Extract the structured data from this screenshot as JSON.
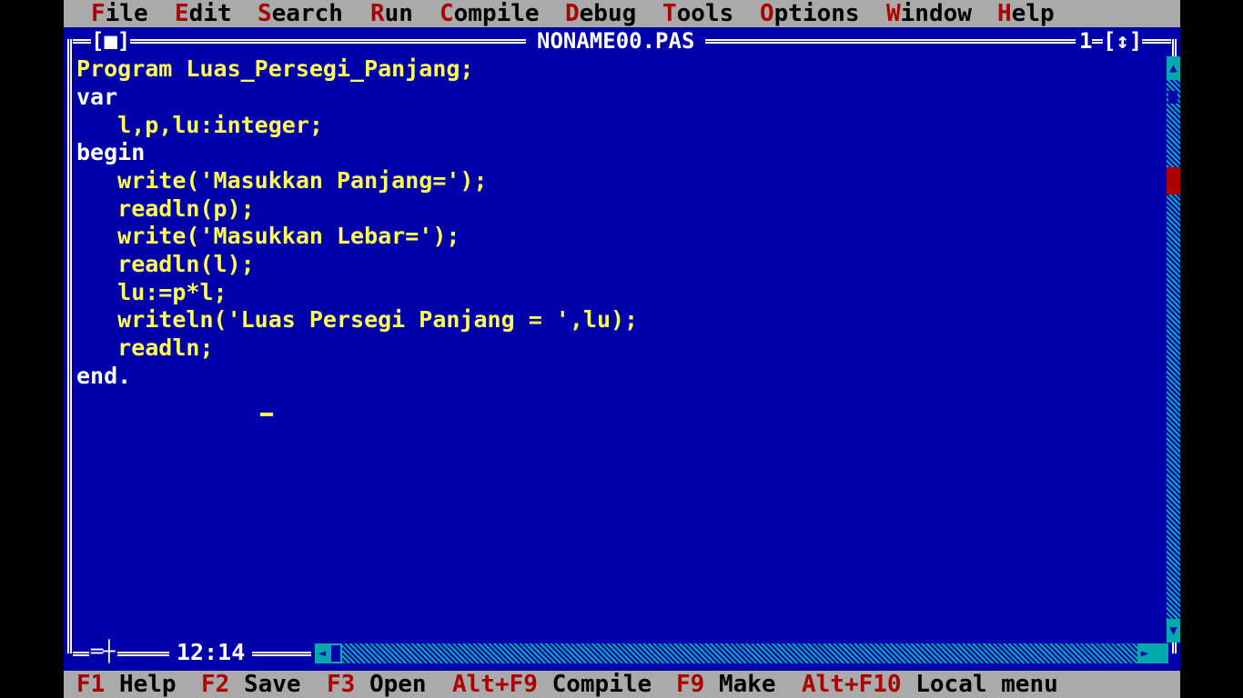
{
  "menu": {
    "items": [
      {
        "hotkey": "F",
        "rest": "ile"
      },
      {
        "hotkey": "E",
        "rest": "dit"
      },
      {
        "hotkey": "S",
        "rest": "earch"
      },
      {
        "hotkey": "R",
        "rest": "un"
      },
      {
        "hotkey": "C",
        "rest": "ompile"
      },
      {
        "hotkey": "D",
        "rest": "ebug"
      },
      {
        "hotkey": "T",
        "rest": "ools"
      },
      {
        "hotkey": "O",
        "rest": "ptions"
      },
      {
        "hotkey": "W",
        "rest": "indow"
      },
      {
        "hotkey": "H",
        "rest": "elp"
      }
    ]
  },
  "window": {
    "close_box": "[■]",
    "title": "NONAME00.PAS",
    "number": "1",
    "zoom_box": "[↕]",
    "position": "12:14"
  },
  "editor": {
    "lines": [
      "Program Luas_Persegi_Panjang;",
      "var",
      "   l,p,lu:integer;",
      "begin",
      "   write('Masukkan Panjang=');",
      "   readln(p);",
      "   write('Masukkan Lebar=');",
      "   readln(l);",
      "   lu:=p*l;",
      "   writeln('Luas Persegi Panjang = ',lu);",
      "   readln;",
      "end."
    ]
  },
  "statusbar": {
    "items": [
      {
        "key": "F1",
        "label": "Help"
      },
      {
        "key": "F2",
        "label": "Save"
      },
      {
        "key": "F3",
        "label": "Open"
      },
      {
        "key": "Alt+F9",
        "label": "Compile"
      },
      {
        "key": "F9",
        "label": "Make"
      },
      {
        "key": "Alt+F10",
        "label": "Local menu"
      }
    ]
  },
  "colors": {
    "background": "#0000aa",
    "menu_bar": "#aaaaaa",
    "hotkey": "#aa0000",
    "code_text": "#ffff55",
    "frame": "#ffffff",
    "scrollbar": "#00aaaa",
    "scroll_thumb": "#aa0000"
  }
}
